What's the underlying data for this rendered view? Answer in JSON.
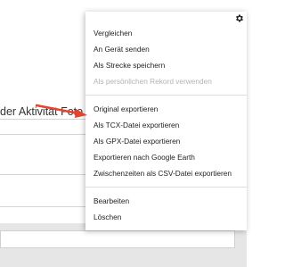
{
  "page": {
    "heading_fragment": "der Aktivität Foto"
  },
  "menu": {
    "icon": "gear-icon",
    "groups": [
      {
        "items": [
          {
            "label": "Vergleichen",
            "disabled": false
          },
          {
            "label": "An Gerät senden",
            "disabled": false
          },
          {
            "label": "Als Strecke speichern",
            "disabled": false
          },
          {
            "label": "Als persönlichen Rekord verwenden",
            "disabled": true
          }
        ]
      },
      {
        "items": [
          {
            "label": "Original exportieren",
            "disabled": false
          },
          {
            "label": "Als TCX-Datei exportieren",
            "disabled": false
          },
          {
            "label": "Als GPX-Datei exportieren",
            "disabled": false
          },
          {
            "label": "Exportieren nach Google Earth",
            "disabled": false
          },
          {
            "label": "Zwischenzeiten als CSV-Datei exportieren",
            "disabled": false
          }
        ]
      },
      {
        "items": [
          {
            "label": "Bearbeiten",
            "disabled": false
          },
          {
            "label": "Löschen",
            "disabled": false
          }
        ]
      }
    ]
  },
  "colors": {
    "annotation_arrow": "#e8432c",
    "disabled_text": "#b4b4b4",
    "footer_bar": "#e6e6e6"
  }
}
